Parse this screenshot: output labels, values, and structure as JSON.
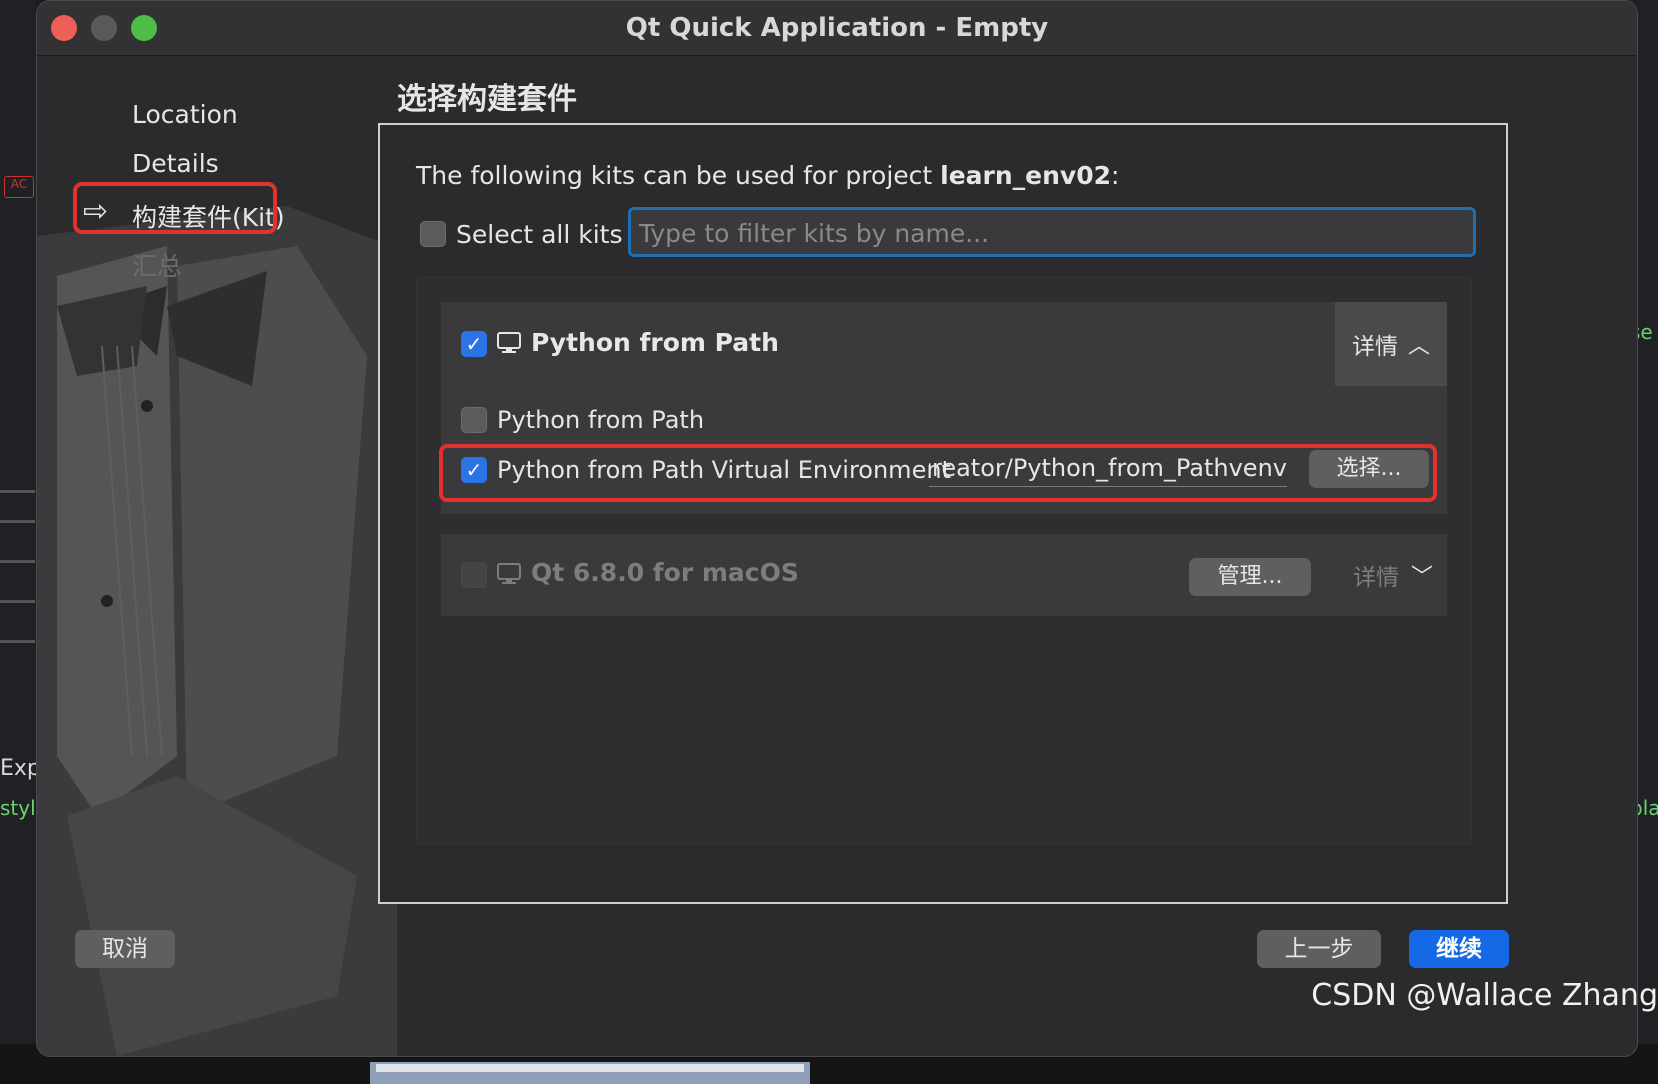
{
  "window": {
    "title": "Qt Quick Application - Empty"
  },
  "steps": [
    {
      "label": "Location"
    },
    {
      "label": "Details"
    },
    {
      "label": "构建套件(Kit)"
    },
    {
      "label": "汇总"
    }
  ],
  "section_title": "选择构建套件",
  "intro": {
    "prefix": "The following kits can be used for project ",
    "project": "learn_env02",
    "suffix": ":"
  },
  "select_all": {
    "label": "Select all kits",
    "checked": false
  },
  "filter": {
    "placeholder": "Type to filter kits by name...",
    "value": ""
  },
  "kits": [
    {
      "name": "Python from Path",
      "checked": true,
      "icon": "monitor-icon",
      "details_label": "详情",
      "expanded": true,
      "options": [
        {
          "label": "Python from Path",
          "checked": false
        },
        {
          "label": "Python from Path Virtual Environment",
          "checked": true,
          "path": "tcreator/Python_from_Pathvenv",
          "button": "选择..."
        }
      ]
    },
    {
      "name": "Qt 6.8.0 for macOS",
      "checked": false,
      "enabled": false,
      "icon": "monitor-icon",
      "manage_label": "管理...",
      "details_label": "详情",
      "expanded": false
    }
  ],
  "footer": {
    "cancel": "取消",
    "back": "上一步",
    "next": "继续"
  },
  "background": {
    "left_text_1": "Exp",
    "left_text_2": "styl",
    "right_text_1": "se",
    "right_text_2": "pla",
    "mini_label_1": "AC"
  },
  "watermark": "CSDN @Wallace Zhang",
  "colors": {
    "accent": "#1669e6",
    "highlight": "#e0332a",
    "focus": "#1d6fb8"
  }
}
